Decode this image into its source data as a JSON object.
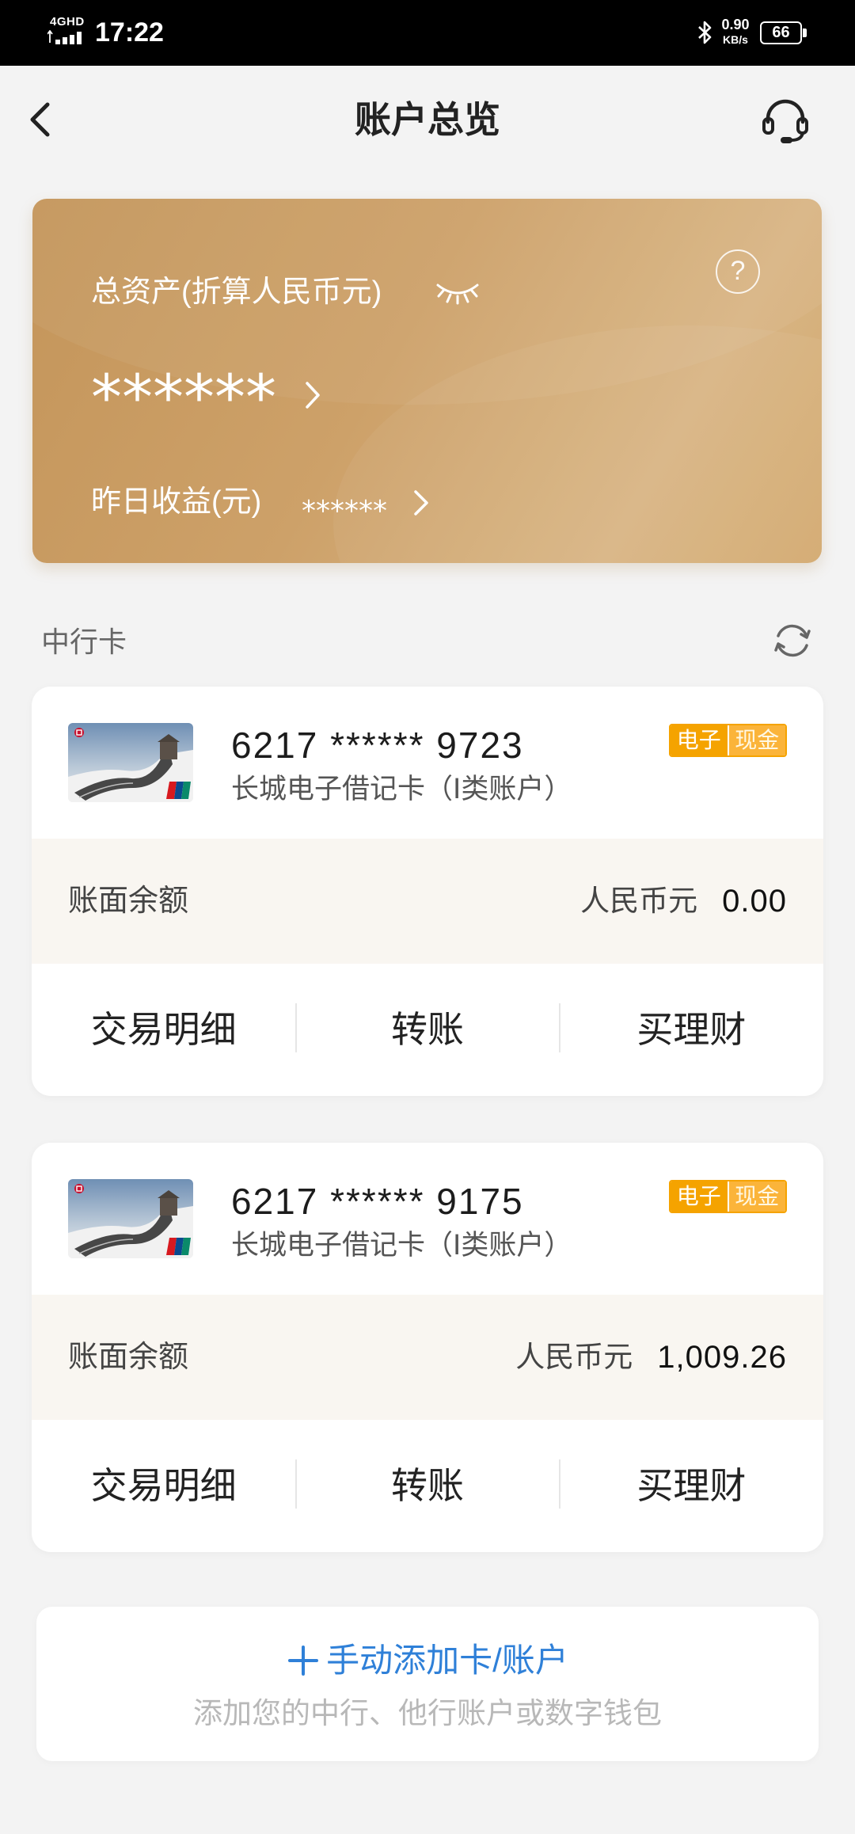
{
  "status_bar": {
    "network": "4GHD",
    "time": "17:22",
    "net_speed": "0.90",
    "net_speed_unit": "KB/s",
    "battery": "66"
  },
  "header": {
    "title": "账户总览",
    "back_icon": "chevron-left-icon",
    "service_icon": "headset-icon"
  },
  "assets_card": {
    "total_label": "总资产(折算人民币元)",
    "total_value": "******",
    "help_glyph": "?",
    "yesterday_label": "昨日收益(元)",
    "yesterday_value": "******",
    "visibility_icon": "eye-closed-icon"
  },
  "section": {
    "title": "中行卡",
    "refresh_icon": "refresh-icon"
  },
  "cards": [
    {
      "number": "6217 ****** 9723",
      "type": "长城电子借记卡（Ⅰ类账户）",
      "badge": {
        "left": "电子",
        "right": "现金"
      },
      "balance_label": "账面余额",
      "currency": "人民币元",
      "balance": "0.00",
      "actions": [
        "交易明细",
        "转账",
        "买理财"
      ]
    },
    {
      "number": "6217 ****** 9175",
      "type": "长城电子借记卡（Ⅰ类账户）",
      "badge": {
        "left": "电子",
        "right": "现金"
      },
      "balance_label": "账面余额",
      "currency": "人民币元",
      "balance": "1,009.26",
      "actions": [
        "交易明细",
        "转账",
        "买理财"
      ]
    }
  ],
  "add_account": {
    "icon": "plus-icon",
    "title": "手动添加卡/账户",
    "subtitle": "添加您的中行、他行账户或数字钱包"
  },
  "colors": {
    "gold_start": "#c4955a",
    "gold_end": "#d8b584",
    "badge_orange": "#f5a300",
    "accent_blue": "#2f80d8"
  }
}
